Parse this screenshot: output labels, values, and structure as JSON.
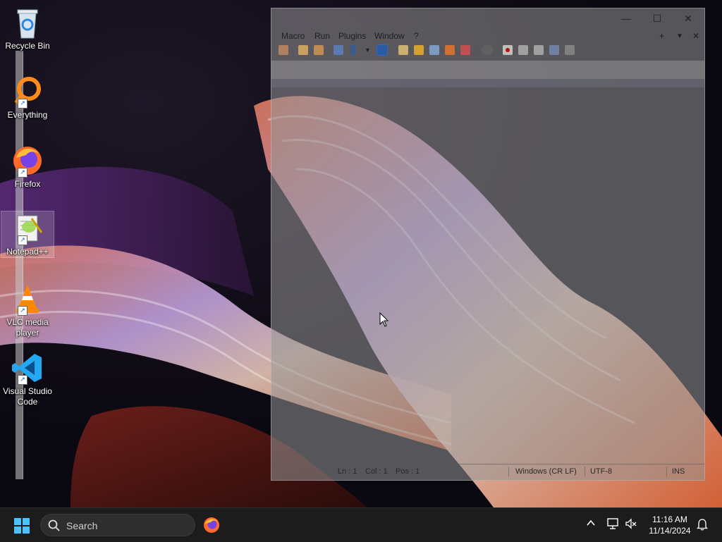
{
  "desktop": {
    "icons": [
      {
        "label": "Recycle Bin",
        "icon": "recycle-bin-icon"
      },
      {
        "label": "Everything",
        "icon": "everything-search-icon"
      },
      {
        "label": "Firefox",
        "icon": "firefox-icon"
      },
      {
        "label": "Notepad++",
        "icon": "notepadpp-icon"
      },
      {
        "label": "VLC media player",
        "icon": "vlc-icon"
      },
      {
        "label": "Visual Studio Code",
        "icon": "vscode-icon"
      }
    ]
  },
  "notepadpp": {
    "menu": [
      "Macro",
      "Run",
      "Plugins",
      "Window",
      "?"
    ],
    "tab_controls": {
      "add": "+",
      "list": "▼",
      "close": "✕"
    },
    "window_controls": {
      "minimize": "—",
      "maximize": "☐",
      "close": "✕"
    },
    "status": {
      "line": "Ln : 1",
      "col": "Col : 1",
      "pos": "Pos : 1",
      "eol": "Windows (CR LF)",
      "encoding": "UTF-8",
      "mode": "INS"
    }
  },
  "taskbar": {
    "search_placeholder": "Search",
    "time": "11:16 AM",
    "date": "11/14/2024"
  },
  "colors": {
    "accent": "#4cc2ff",
    "taskbar": "#1c1c1c"
  }
}
